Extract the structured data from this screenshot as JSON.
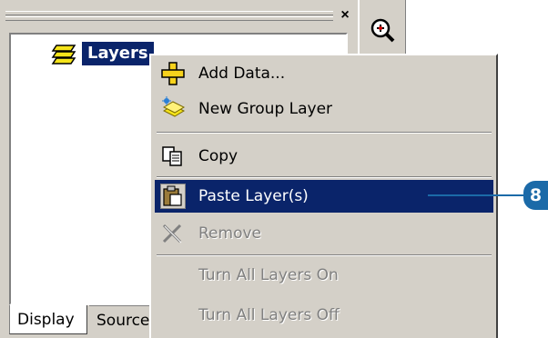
{
  "toc": {
    "close_glyph": "×",
    "root_layer_label": "Layers",
    "tabs": [
      {
        "label": "Display"
      },
      {
        "label": "Source"
      }
    ]
  },
  "context_menu": {
    "items": [
      {
        "label": "Add Data...",
        "icon": "add-data-icon",
        "state": "enabled"
      },
      {
        "label": "New Group Layer",
        "icon": "new-group-layer-icon",
        "state": "enabled"
      },
      {
        "label": "Copy",
        "icon": "copy-icon",
        "state": "enabled"
      },
      {
        "label": "Paste Layer(s)",
        "icon": "paste-icon",
        "state": "highlighted"
      },
      {
        "label": "Remove",
        "icon": "remove-icon",
        "state": "disabled"
      },
      {
        "label": "Turn All Layers On",
        "icon": "",
        "state": "disabled"
      },
      {
        "label": "Turn All Layers Off",
        "icon": "",
        "state": "disabled"
      }
    ]
  },
  "callout": {
    "number": "8",
    "color": "#1b6aa8"
  },
  "colors": {
    "highlight": "#0a246a",
    "face": "#d4d0c8"
  }
}
